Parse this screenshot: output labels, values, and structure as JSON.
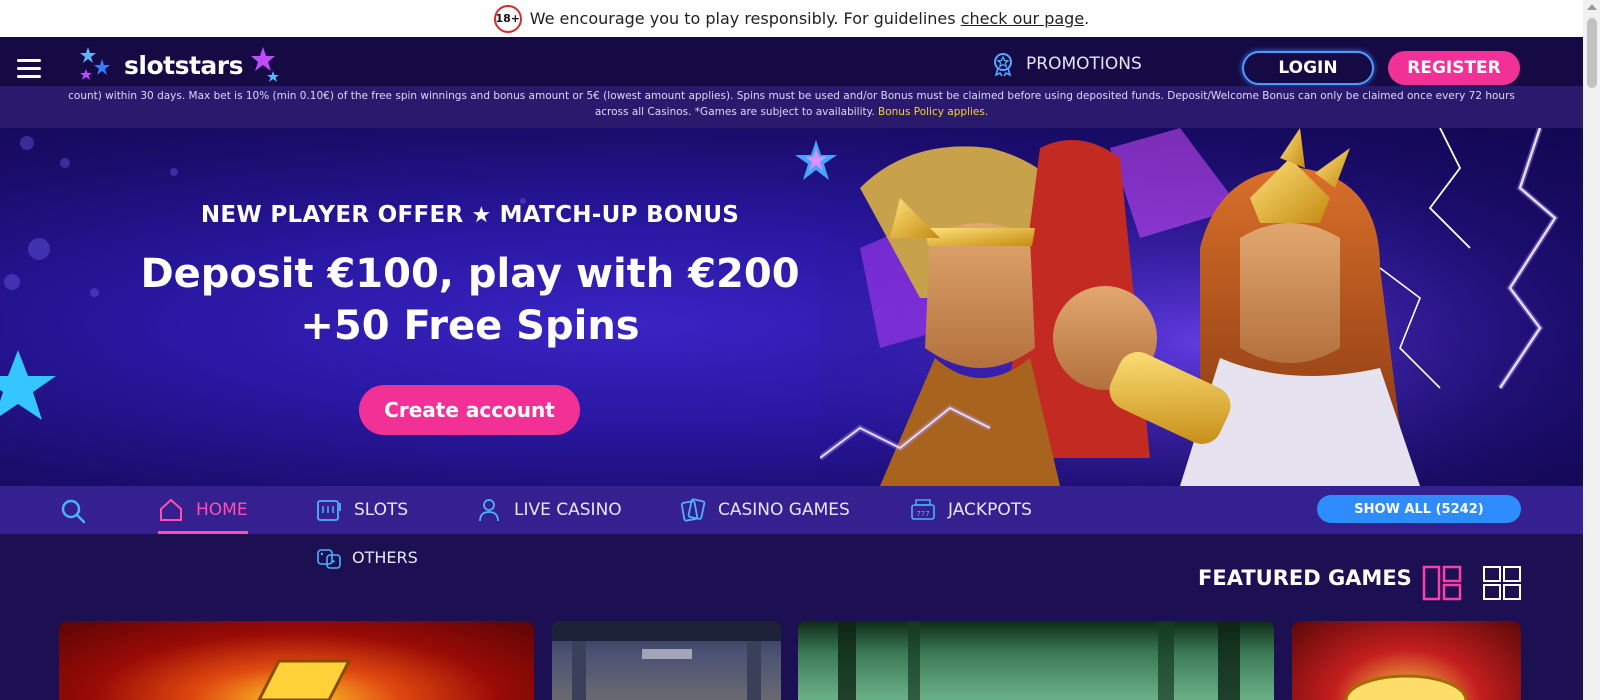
{
  "responsible": {
    "badge": "18+",
    "text": "We encourage you to play responsibly. For guidelines",
    "link": "check our page",
    "end": "."
  },
  "header": {
    "logo": "slotstars",
    "promotions": "PROMOTIONS",
    "login": "LOGIN",
    "register": "REGISTER"
  },
  "terms": {
    "text": "count) within 30 days. Max bet is 10% (min 0.10€) of the free spin winnings and bonus amount or 5€ (lowest amount applies). Spins must be used and/or Bonus must be claimed before using deposited funds. Deposit/Welcome Bonus can only be claimed once every 72 hours across all Casinos. *Games are subject to availability.",
    "policy_link": "Bonus Policy applies."
  },
  "hero": {
    "sub_left": "NEW PLAYER OFFER",
    "sub_right": "MATCH-UP BONUS",
    "title_line1": "Deposit €100, play with €200",
    "title_line2": "+50 Free Spins",
    "cta": "Create account"
  },
  "nav": {
    "items": [
      {
        "label": "HOME",
        "icon": "home-icon"
      },
      {
        "label": "SLOTS",
        "icon": "slot-machine-icon"
      },
      {
        "label": "LIVE CASINO",
        "icon": "person-icon"
      },
      {
        "label": "CASINO GAMES",
        "icon": "cards-icon"
      },
      {
        "label": "JACKPOTS",
        "icon": "jackpot-icon"
      }
    ],
    "others": "OTHERS",
    "show_all": "SHOW ALL (5242)"
  },
  "featured": {
    "title": "FEATURED GAMES"
  },
  "colors": {
    "brand_pink": "#f23197",
    "accent_blue": "#2e8cff",
    "nav_bg": "#34208f",
    "page_bg": "#1c0f52"
  }
}
